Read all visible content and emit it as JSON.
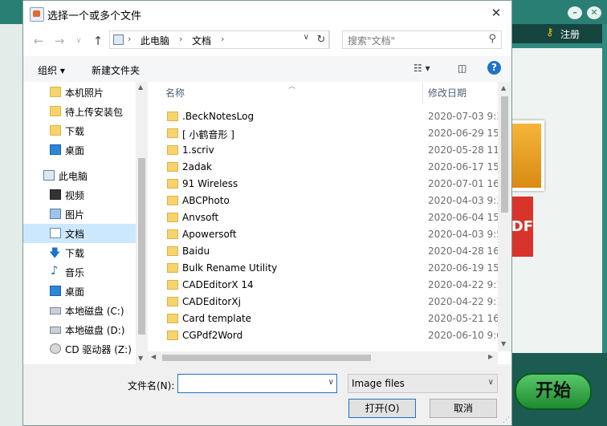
{
  "dialog": {
    "title": "选择一个或多个文件",
    "close_glyph": "✕"
  },
  "address": {
    "segments": [
      "此电脑",
      "文档"
    ],
    "search_placeholder": "搜索\"文档\""
  },
  "command_bar": {
    "organize_label": "组织 ▾",
    "new_folder_label": "新建文件夹",
    "help_glyph": "?"
  },
  "nav_pane": {
    "items": [
      {
        "label": "本机照片",
        "icon": "folder-icon"
      },
      {
        "label": "待上传安装包",
        "icon": "folder-icon"
      },
      {
        "label": "下载",
        "icon": "folder-icon"
      },
      {
        "label": "桌面",
        "icon": "desktop-icon"
      },
      {
        "label": "此电脑",
        "icon": "computer-icon"
      },
      {
        "label": "视频",
        "icon": "video-icon"
      },
      {
        "label": "图片",
        "icon": "pictures-icon"
      },
      {
        "label": "文档",
        "icon": "documents-icon",
        "selected": true
      },
      {
        "label": "下载",
        "icon": "download-icon"
      },
      {
        "label": "音乐",
        "icon": "music-icon"
      },
      {
        "label": "桌面",
        "icon": "desktop-icon"
      },
      {
        "label": "本地磁盘 (C:)",
        "icon": "drive-icon"
      },
      {
        "label": "本地磁盘 (D:)",
        "icon": "drive-icon"
      },
      {
        "label": "CD 驱动器 (Z:)",
        "icon": "cd-drive-icon"
      }
    ]
  },
  "file_list": {
    "columns": {
      "name": "名称",
      "modified": "修改日期"
    },
    "rows": [
      {
        "name": ".BeckNotesLog",
        "date": "2020-07-03 9:3"
      },
      {
        "name": "[ 小鹤音形 ]",
        "date": "2020-06-29 15:"
      },
      {
        "name": "1.scriv",
        "date": "2020-05-28 11:"
      },
      {
        "name": "2adak",
        "date": "2020-06-17 15:"
      },
      {
        "name": "91 Wireless",
        "date": "2020-07-01 16:"
      },
      {
        "name": "ABCPhoto",
        "date": "2020-04-03 9:3"
      },
      {
        "name": "Anvsoft",
        "date": "2020-06-04 15:"
      },
      {
        "name": "Apowersoft",
        "date": "2020-04-03 9:5"
      },
      {
        "name": "Baidu",
        "date": "2020-04-28 16:"
      },
      {
        "name": "Bulk Rename Utility",
        "date": "2020-06-19 15:"
      },
      {
        "name": "CADEditorX 14",
        "date": "2020-04-22 9:1"
      },
      {
        "name": "CADEditorXj",
        "date": "2020-04-22 9:1"
      },
      {
        "name": "Card template",
        "date": "2020-05-21 16:"
      },
      {
        "name": "CGPdf2Word",
        "date": "2020-06-10 9:0"
      }
    ]
  },
  "bottom": {
    "filename_label": "文件名(N):",
    "filename_value": "",
    "filetype_value": "Image files",
    "open_label": "打开(O)",
    "cancel_label": "取消"
  },
  "background_app": {
    "register_label": "注册",
    "start_label": "开始",
    "pdf_text": "DF"
  }
}
